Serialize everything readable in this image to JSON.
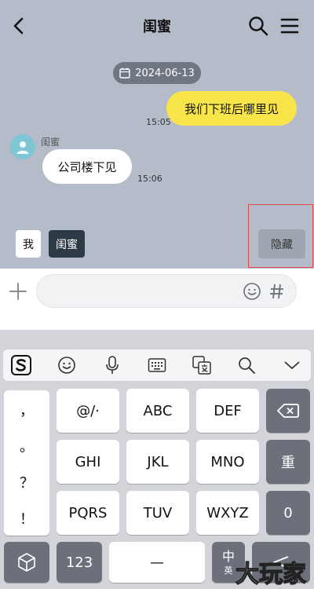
{
  "header": {
    "title": "闺蜜"
  },
  "chat": {
    "date": "2024-06-13",
    "messages": [
      {
        "side": "right",
        "text": "我们下班后哪里见",
        "time": "15:05"
      },
      {
        "side": "left",
        "sender": "闺蜜",
        "text": "公司楼下见",
        "time": "15:06"
      }
    ],
    "roles": {
      "me": "我",
      "friend": "闺蜜"
    },
    "hide_label": "隐藏"
  },
  "input": {
    "placeholder": ""
  },
  "keyboard": {
    "punct": [
      "，",
      "。",
      "？",
      "！"
    ],
    "row1": [
      "@/·",
      "ABC",
      "DEF"
    ],
    "row2": [
      "GHI",
      "JKL",
      "MNO"
    ],
    "row3": [
      "PQRS",
      "TUV",
      "WXYZ"
    ],
    "right_col": {
      "delete": "⌫",
      "reenter": "重",
      "zero": "0"
    },
    "bottom": {
      "numbers": "123",
      "space": "—",
      "lang_top": "中",
      "lang_bottom": "英"
    }
  },
  "watermark": "大玩家",
  "colors": {
    "chat_bg": "#b3bcc8",
    "my_bubble": "#f8e54a",
    "friend_bubble": "#ffffff",
    "date_pill": "#6f7783",
    "avatar": "#7fc6d4",
    "role_selected": "#2d3944",
    "highlight_outline": "#e14b4b"
  },
  "icons": {
    "back": "chevron-left-icon",
    "search": "search-icon",
    "menu": "menu-icon",
    "calendar": "calendar-icon",
    "avatar": "person-icon",
    "plus": "plus-icon",
    "emoji": "smiley-icon",
    "hash": "hash-icon",
    "sogou": "sogou-logo-icon",
    "voice": "microphone-icon",
    "keyboard": "keyboard-icon",
    "translate": "translate-icon",
    "collapse": "chevron-down-icon"
  }
}
